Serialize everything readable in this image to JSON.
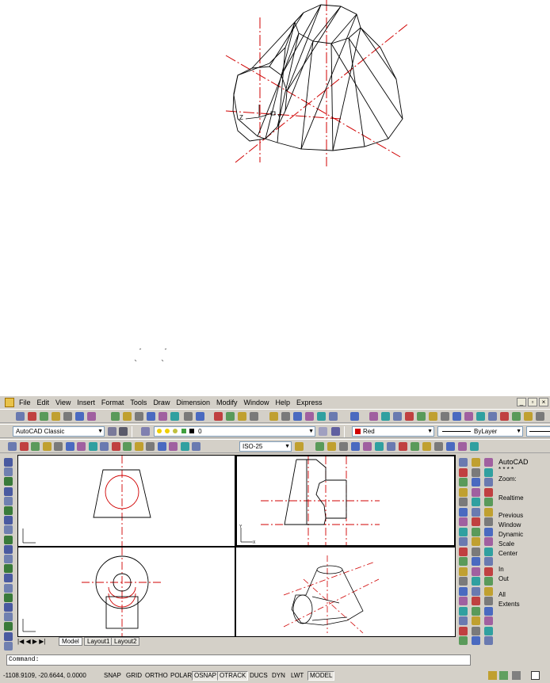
{
  "menu": [
    "File",
    "Edit",
    "View",
    "Insert",
    "Format",
    "Tools",
    "Draw",
    "Dimension",
    "Modify",
    "Window",
    "Help",
    "Express"
  ],
  "window_buttons": [
    "_",
    "▫",
    "×"
  ],
  "workspace": "AutoCAD Classic",
  "layer_name": "0",
  "color_value": "Red",
  "linetype_value": "ByLayer",
  "dimstyle_value": "ISO-25",
  "axis_labels": {
    "z": "Z",
    "y": "Y",
    "vp_y": "Y",
    "vp_x": "X"
  },
  "right_panel": {
    "title": "AutoCAD",
    "stars": "* * * *",
    "items": [
      "Zoom:",
      "Realtime",
      "Previous",
      "Window",
      "Dynamic",
      "Scale",
      "Center",
      "In",
      "Out",
      "All",
      "Extents"
    ]
  },
  "tabs": [
    "Model",
    "Layout1",
    "Layout2"
  ],
  "command_prompt": "Command:",
  "coordinates": "-1108.9109, -20.6644, 0.0000",
  "status_buttons": [
    {
      "label": "SNAP",
      "on": false
    },
    {
      "label": "GRID",
      "on": false
    },
    {
      "label": "ORTHO",
      "on": false
    },
    {
      "label": "POLAR",
      "on": false
    },
    {
      "label": "OSNAP",
      "on": true
    },
    {
      "label": "OTRACK",
      "on": true
    },
    {
      "label": "DUCS",
      "on": false
    },
    {
      "label": "DYN",
      "on": false
    },
    {
      "label": "LWT",
      "on": false
    },
    {
      "label": "MODEL",
      "on": true
    }
  ],
  "colors": {
    "accent_red": "#d00000",
    "face": "#d4d0c8"
  }
}
